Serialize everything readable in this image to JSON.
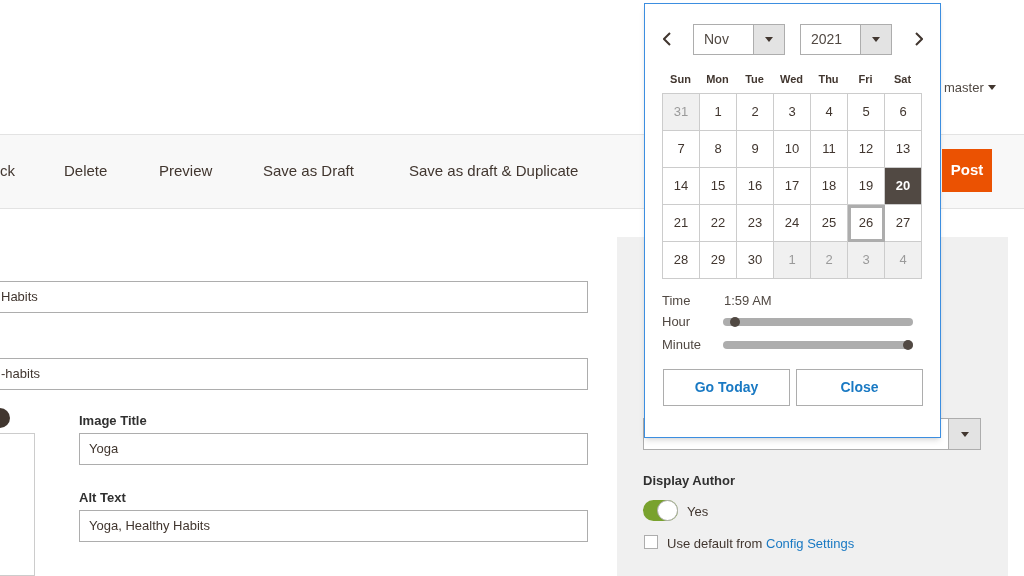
{
  "header": {
    "user": "master"
  },
  "toolbar": {
    "buttons": [
      {
        "label": "ck",
        "kind": "link"
      },
      {
        "label": "Delete",
        "kind": "link"
      },
      {
        "label": "Preview",
        "kind": "link"
      },
      {
        "label": "Save as Draft",
        "kind": "link"
      },
      {
        "label": "Save as draft & Duplicate",
        "kind": "link"
      },
      {
        "label": "Post",
        "kind": "primary"
      }
    ]
  },
  "form": {
    "title_value": "Habits",
    "url_key_value": "-habits",
    "image_title": {
      "label": "Image Title",
      "value": "Yoga"
    },
    "alt_text": {
      "label": "Alt Text",
      "value": "Yoga, Healthy Habits"
    }
  },
  "sidebar": {
    "display_author": {
      "label": "Display Author",
      "on": true,
      "state_label": "Yes"
    },
    "use_default": {
      "checked": false,
      "text": "Use default from ",
      "link": "Config Settings"
    }
  },
  "datepicker": {
    "month": "Nov",
    "year": "2021",
    "weekdays": [
      "Sun",
      "Mon",
      "Tue",
      "Wed",
      "Thu",
      "Fri",
      "Sat"
    ],
    "weeks": [
      [
        {
          "day": "31",
          "other_month": true,
          "selected": false,
          "today": false
        },
        {
          "day": "1",
          "other_month": false,
          "selected": false,
          "today": false
        },
        {
          "day": "2",
          "other_month": false,
          "selected": false,
          "today": false
        },
        {
          "day": "3",
          "other_month": false,
          "selected": false,
          "today": false
        },
        {
          "day": "4",
          "other_month": false,
          "selected": false,
          "today": false
        },
        {
          "day": "5",
          "other_month": false,
          "selected": false,
          "today": false
        },
        {
          "day": "6",
          "other_month": false,
          "selected": false,
          "today": false
        }
      ],
      [
        {
          "day": "7",
          "other_month": false,
          "selected": false,
          "today": false
        },
        {
          "day": "8",
          "other_month": false,
          "selected": false,
          "today": false
        },
        {
          "day": "9",
          "other_month": false,
          "selected": false,
          "today": false
        },
        {
          "day": "10",
          "other_month": false,
          "selected": false,
          "today": false
        },
        {
          "day": "11",
          "other_month": false,
          "selected": false,
          "today": false
        },
        {
          "day": "12",
          "other_month": false,
          "selected": false,
          "today": false
        },
        {
          "day": "13",
          "other_month": false,
          "selected": false,
          "today": false
        }
      ],
      [
        {
          "day": "14",
          "other_month": false,
          "selected": false,
          "today": false
        },
        {
          "day": "15",
          "other_month": false,
          "selected": false,
          "today": false
        },
        {
          "day": "16",
          "other_month": false,
          "selected": false,
          "today": false
        },
        {
          "day": "17",
          "other_month": false,
          "selected": false,
          "today": false
        },
        {
          "day": "18",
          "other_month": false,
          "selected": false,
          "today": false
        },
        {
          "day": "19",
          "other_month": false,
          "selected": false,
          "today": false
        },
        {
          "day": "20",
          "other_month": false,
          "selected": true,
          "today": false
        }
      ],
      [
        {
          "day": "21",
          "other_month": false,
          "selected": false,
          "today": false
        },
        {
          "day": "22",
          "other_month": false,
          "selected": false,
          "today": false
        },
        {
          "day": "23",
          "other_month": false,
          "selected": false,
          "today": false
        },
        {
          "day": "24",
          "other_month": false,
          "selected": false,
          "today": false
        },
        {
          "day": "25",
          "other_month": false,
          "selected": false,
          "today": false
        },
        {
          "day": "26",
          "other_month": false,
          "selected": false,
          "today": true
        },
        {
          "day": "27",
          "other_month": false,
          "selected": false,
          "today": false
        }
      ],
      [
        {
          "day": "28",
          "other_month": false,
          "selected": false,
          "today": false
        },
        {
          "day": "29",
          "other_month": false,
          "selected": false,
          "today": false
        },
        {
          "day": "30",
          "other_month": false,
          "selected": false,
          "today": false
        },
        {
          "day": "1",
          "other_month": true,
          "selected": false,
          "today": false
        },
        {
          "day": "2",
          "other_month": true,
          "selected": false,
          "today": false
        },
        {
          "day": "3",
          "other_month": true,
          "selected": false,
          "today": false
        },
        {
          "day": "4",
          "other_month": true,
          "selected": false,
          "today": false
        }
      ]
    ],
    "time": {
      "label": "Time",
      "value": "1:59 AM"
    },
    "sliders": [
      {
        "label": "Hour",
        "level": 0.04
      },
      {
        "label": "Minute",
        "level": 1
      }
    ],
    "buttons": [
      "Go Today",
      "Close"
    ]
  }
}
